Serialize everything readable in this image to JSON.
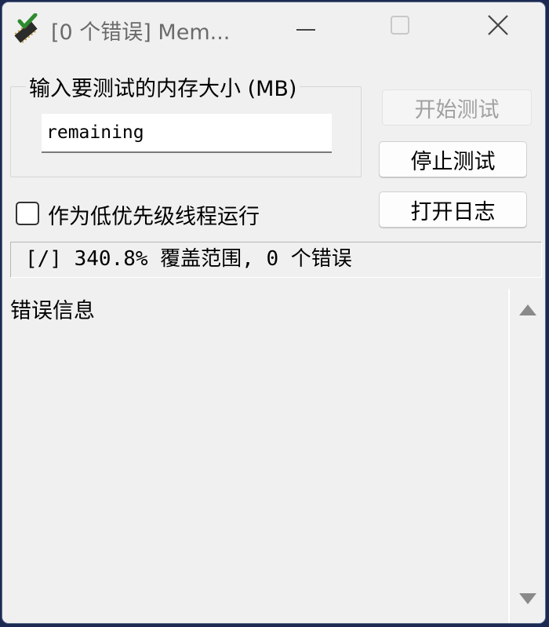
{
  "window": {
    "title": "[0 个错误] Mem..."
  },
  "group": {
    "legend": "输入要测试的内存大小 (MB)",
    "input_value": "remaining"
  },
  "buttons": {
    "start": "开始测试",
    "stop": "停止测试",
    "log": "打开日志"
  },
  "checkbox": {
    "label": "作为低优先级线程运行",
    "checked": false
  },
  "status": {
    "text": "[/]  340.8% 覆盖范围, 0 个错误"
  },
  "errors": {
    "header": "错误信息"
  },
  "icons": {
    "app": "memory-chip-check-icon",
    "minimize": "minimize-icon",
    "maximize": "maximize-icon",
    "close": "close-icon",
    "scroll_up": "scroll-up-arrow-icon",
    "scroll_down": "scroll-down-arrow-icon"
  },
  "colors": {
    "desktop": "#1c2a52",
    "window_bg": "#f0f0f0",
    "check_green": "#2e8b2e"
  }
}
